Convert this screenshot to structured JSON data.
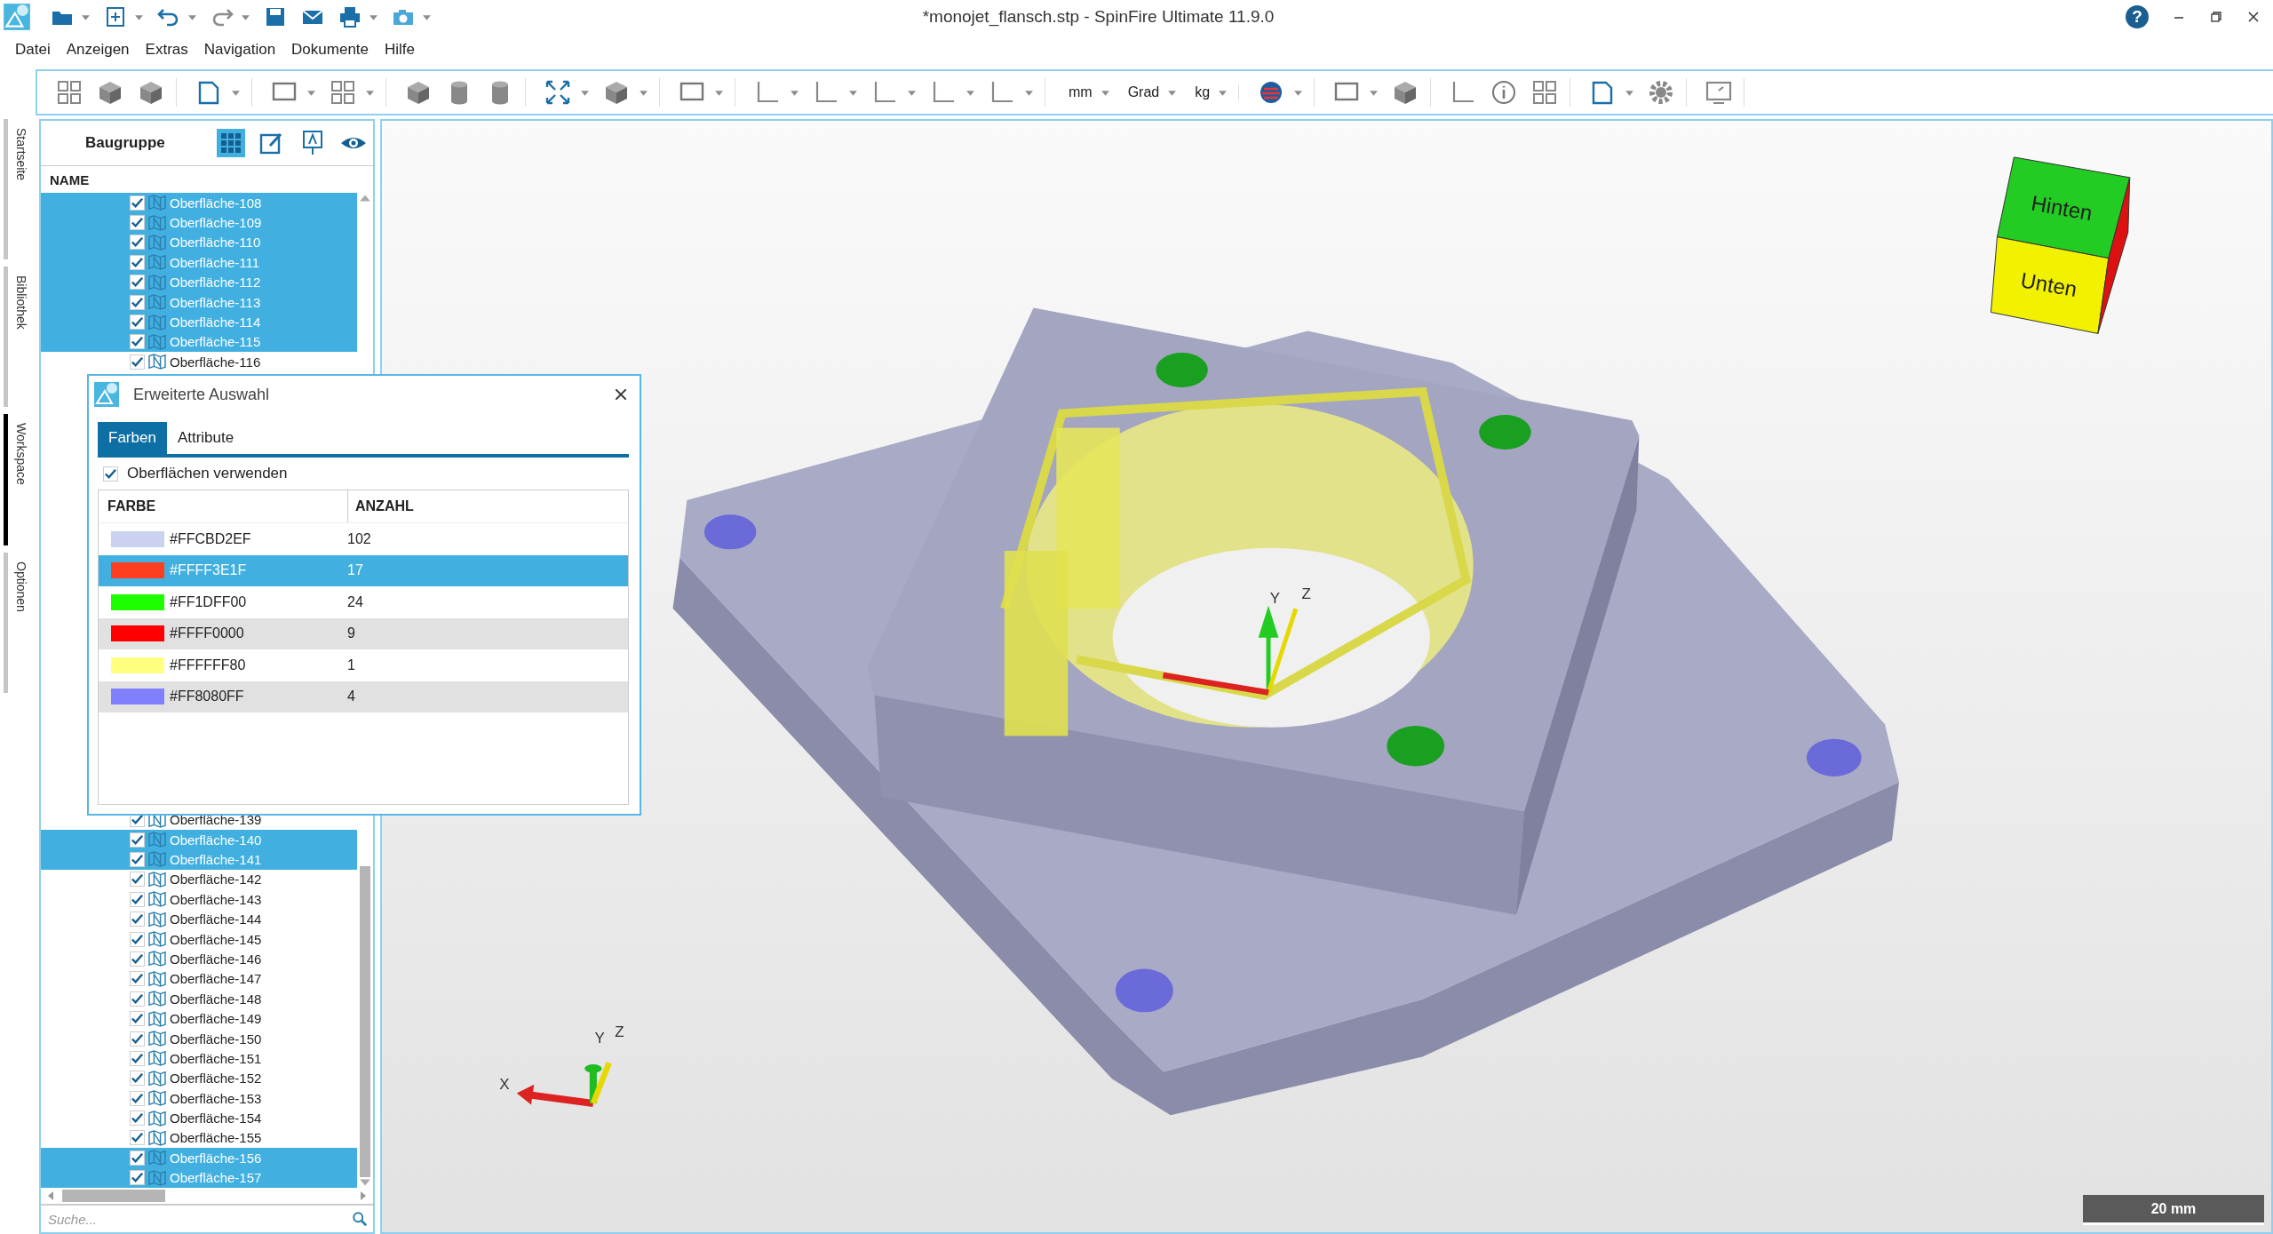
{
  "window": {
    "title": "*monojet_flansch.stp - SpinFire Ultimate 11.9.0",
    "help": "?"
  },
  "menu": [
    "Datei",
    "Anzeigen",
    "Extras",
    "Navigation",
    "Dokumente",
    "Hilfe"
  ],
  "toolbar": {
    "units": [
      {
        "label": "mm"
      },
      {
        "label": "Grad"
      },
      {
        "label": "kg"
      }
    ]
  },
  "side_tabs": [
    {
      "label": "Startseite",
      "selected": false
    },
    {
      "label": "Bibliothek",
      "selected": false
    },
    {
      "label": "Workspace",
      "selected": true
    },
    {
      "label": "Optionen",
      "selected": false
    }
  ],
  "tree": {
    "title": "Baugruppe",
    "column": "NAME",
    "search": {
      "placeholder": "Suche..."
    },
    "top_rows": [
      {
        "label": "Oberfläche-108",
        "checked": true,
        "selected": true
      },
      {
        "label": "Oberfläche-109",
        "checked": true,
        "selected": true
      },
      {
        "label": "Oberfläche-110",
        "checked": true,
        "selected": true
      },
      {
        "label": "Oberfläche-111",
        "checked": true,
        "selected": true
      },
      {
        "label": "Oberfläche-112",
        "checked": true,
        "selected": true
      },
      {
        "label": "Oberfläche-113",
        "checked": true,
        "selected": true
      },
      {
        "label": "Oberfläche-114",
        "checked": true,
        "selected": true
      },
      {
        "label": "Oberfläche-115",
        "checked": true,
        "selected": true
      },
      {
        "label": "Oberfläche-116",
        "checked": true,
        "selected": false
      }
    ],
    "bottom_rows": [
      {
        "label": "Oberfläche-139",
        "checked": true,
        "selected": false
      },
      {
        "label": "Oberfläche-140",
        "checked": true,
        "selected": true
      },
      {
        "label": "Oberfläche-141",
        "checked": true,
        "selected": true
      },
      {
        "label": "Oberfläche-142",
        "checked": true,
        "selected": false
      },
      {
        "label": "Oberfläche-143",
        "checked": true,
        "selected": false
      },
      {
        "label": "Oberfläche-144",
        "checked": true,
        "selected": false
      },
      {
        "label": "Oberfläche-145",
        "checked": true,
        "selected": false
      },
      {
        "label": "Oberfläche-146",
        "checked": true,
        "selected": false
      },
      {
        "label": "Oberfläche-147",
        "checked": true,
        "selected": false
      },
      {
        "label": "Oberfläche-148",
        "checked": true,
        "selected": false
      },
      {
        "label": "Oberfläche-149",
        "checked": true,
        "selected": false
      },
      {
        "label": "Oberfläche-150",
        "checked": true,
        "selected": false
      },
      {
        "label": "Oberfläche-151",
        "checked": true,
        "selected": false
      },
      {
        "label": "Oberfläche-152",
        "checked": true,
        "selected": false
      },
      {
        "label": "Oberfläche-153",
        "checked": true,
        "selected": false
      },
      {
        "label": "Oberfläche-154",
        "checked": true,
        "selected": false
      },
      {
        "label": "Oberfläche-155",
        "checked": true,
        "selected": false
      },
      {
        "label": "Oberfläche-156",
        "checked": true,
        "selected": true
      },
      {
        "label": "Oberfläche-157",
        "checked": true,
        "selected": true
      }
    ]
  },
  "dialog": {
    "title": "Erweiterte Auswahl",
    "tabs": [
      {
        "label": "Farben",
        "selected": true
      },
      {
        "label": "Attribute",
        "selected": false
      }
    ],
    "option": {
      "label": "Oberflächen verwenden",
      "checked": true
    },
    "columns": [
      "FARBE",
      "ANZAHL"
    ],
    "rows": [
      {
        "label": "#FFCBD2EF",
        "count": "102",
        "color": "#cbd2ef",
        "selected": false
      },
      {
        "label": "#FFFF3E1F",
        "count": "17",
        "color": "#ff3e1f",
        "selected": true
      },
      {
        "label": "#FF1DFF00",
        "count": "24",
        "color": "#1dff00",
        "selected": false
      },
      {
        "label": "#FFFF0000",
        "count": "9",
        "color": "#ff0000",
        "selected": false
      },
      {
        "label": "#FFFFFF80",
        "count": "1",
        "color": "#ffff80",
        "selected": false
      },
      {
        "label": "#FF8080FF",
        "count": "4",
        "color": "#8080ff",
        "selected": false
      }
    ]
  },
  "viewport": {
    "view_cube": {
      "top": "Hinten",
      "front": "Unten"
    },
    "model_axes": [
      "Y",
      "Z"
    ],
    "axes": [
      "X",
      "Y",
      "Z"
    ],
    "scale": "20 mm"
  }
}
